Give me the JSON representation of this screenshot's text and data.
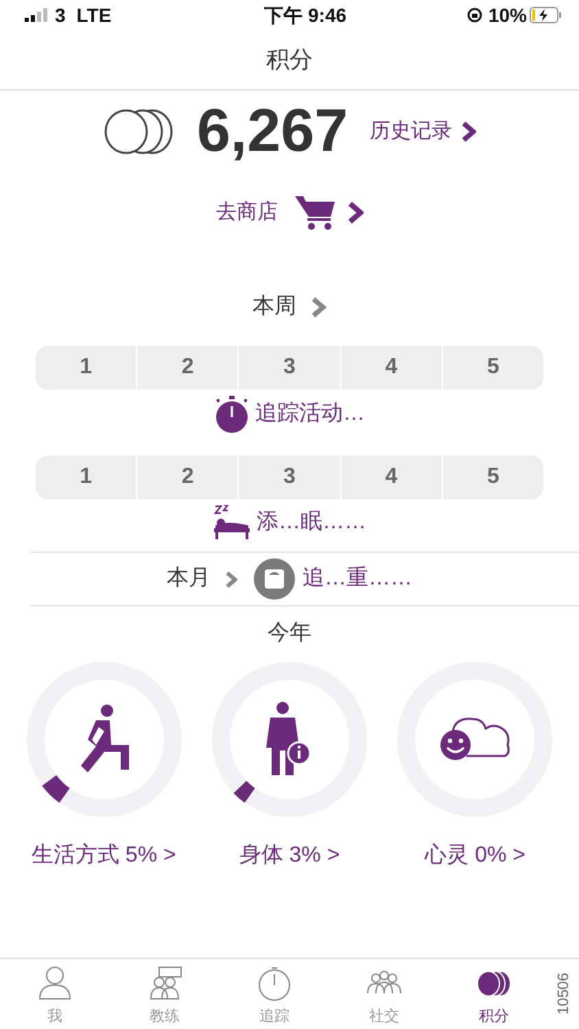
{
  "status_bar": {
    "signal": "3",
    "network": "LTE",
    "time": "下午 9:46",
    "battery": "10%"
  },
  "header": {
    "title": "积分"
  },
  "points": {
    "value": "6,267",
    "history_link": "历史记录"
  },
  "store_link": "去商店",
  "week": {
    "label": "本周",
    "rows": [
      {
        "numbers": [
          "1",
          "2",
          "3",
          "4",
          "5"
        ],
        "action": {
          "kind": "activity",
          "text": "追踪活动…"
        }
      },
      {
        "numbers": [
          "1",
          "2",
          "3",
          "4",
          "5"
        ],
        "action": {
          "kind": "sleep",
          "text": "添…眠……"
        }
      }
    ]
  },
  "month": {
    "label": "本月",
    "action": {
      "kind": "weight",
      "text": "追…重……"
    }
  },
  "year": {
    "title": "今年",
    "goals": [
      {
        "kind": "lifestyle",
        "label": "生活方式 5% >",
        "level": 0.05
      },
      {
        "kind": "body",
        "label": "身体 3% >",
        "level": 0.03
      },
      {
        "kind": "mind",
        "label": "心灵 0% >",
        "level": 0
      }
    ]
  },
  "tabs": [
    {
      "kind": "me",
      "label": "我",
      "selected": false
    },
    {
      "kind": "coach",
      "label": "教练",
      "selected": false
    },
    {
      "kind": "track",
      "label": "追踪",
      "selected": false
    },
    {
      "kind": "social",
      "label": "社交",
      "selected": false
    },
    {
      "kind": "points",
      "label": "积分",
      "selected": true
    }
  ],
  "side_code": "10506"
}
